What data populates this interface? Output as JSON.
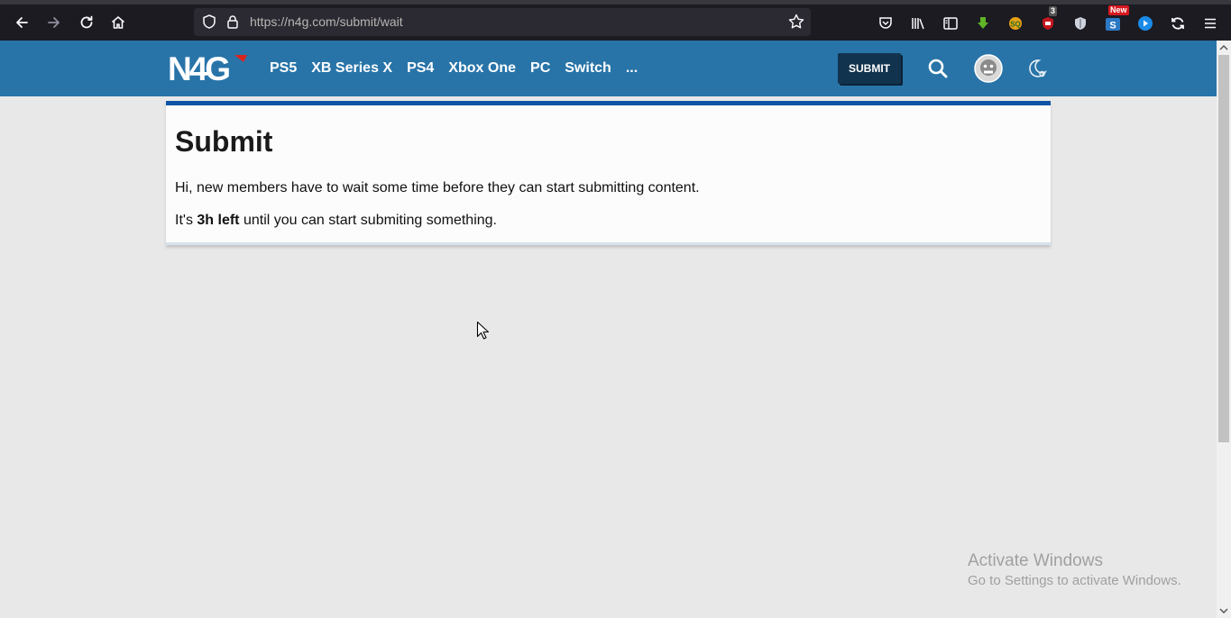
{
  "browser": {
    "url": "https://n4g.com/submit/wait",
    "extension_badge_count": "3",
    "extension_badge_new": "New"
  },
  "header": {
    "logo_text": "N4G",
    "nav": [
      "PS5",
      "XB Series X",
      "PS4",
      "Xbox One",
      "PC",
      "Switch",
      "..."
    ],
    "submit_label": "SUBMIT"
  },
  "content": {
    "title": "Submit",
    "message": "Hi, new members have to wait some time before they can start submitting content.",
    "wait_prefix": "It's ",
    "wait_time": "3h left",
    "wait_suffix": " until you can start submiting something."
  },
  "watermark": {
    "line1": "Activate Windows",
    "line2": "Go to Settings to activate Windows."
  },
  "colors": {
    "header_bg": "#2874a8",
    "card_accent": "#1054a5",
    "submit_bg": "#12334e"
  }
}
